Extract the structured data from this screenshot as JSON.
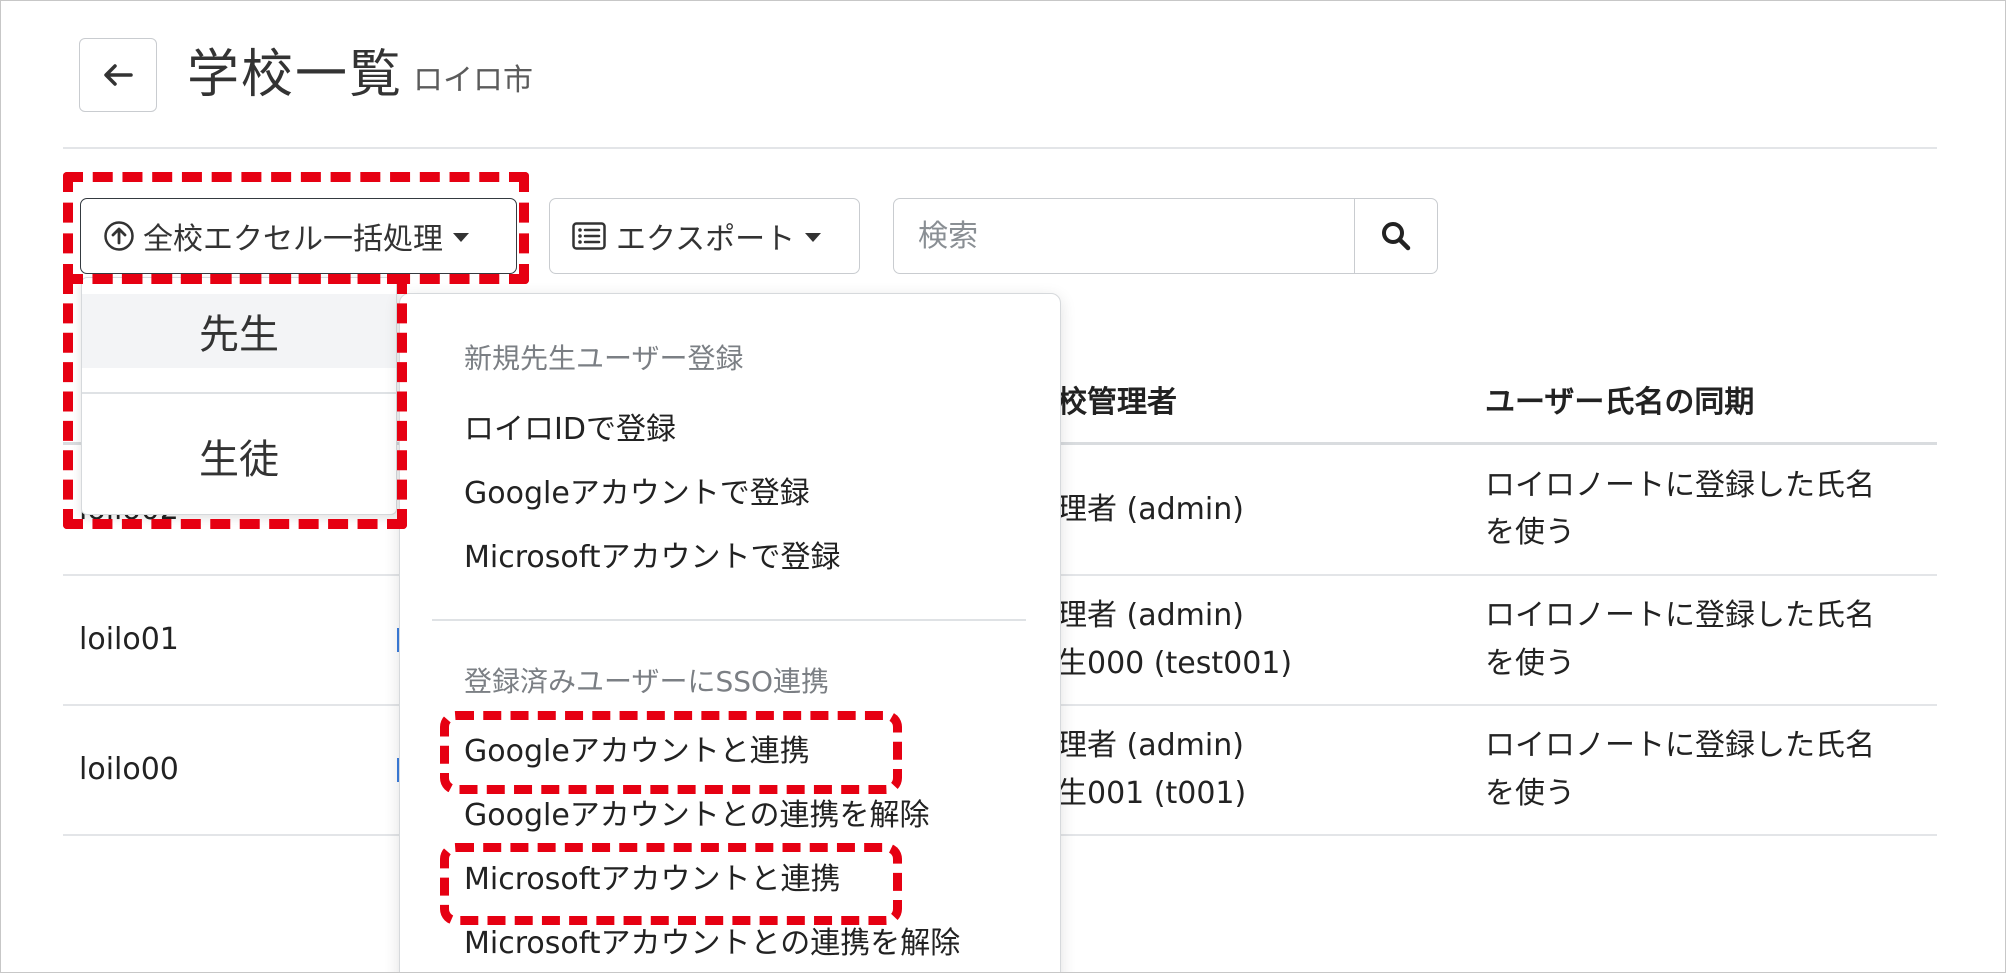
{
  "header": {
    "title": "学校一覧",
    "subtitle": "ロイロ市",
    "back_icon": "arrow-left-icon"
  },
  "toolbar": {
    "bulk_label": "全校エクセル一括処理",
    "bulk_icon": "upload-circle-icon",
    "export_label": "エクスポート",
    "export_icon": "list-icon",
    "search_placeholder": "検索",
    "search_icon": "search-icon"
  },
  "table": {
    "columns": [
      "校管理者",
      "ユーザー氏名の同期"
    ],
    "rows": [
      {
        "code": "loilo02",
        "admin": [
          "理者 (admin)"
        ],
        "sync": [
          "ロイロノートに登録した氏名",
          "を使う"
        ]
      },
      {
        "code": "loilo01",
        "admin": [
          "理者 (admin)",
          "生000 (test001)"
        ],
        "sync": [
          "ロイロノートに登録した氏名",
          "を使う"
        ]
      },
      {
        "code": "loilo00",
        "admin": [
          "理者 (admin)",
          "生001 (t001)"
        ],
        "sync": [
          "ロイロノートに登録した氏名",
          "を使う"
        ]
      }
    ]
  },
  "mini_menu": {
    "items": [
      "先生",
      "生徒"
    ],
    "active": "先生"
  },
  "dropdown": {
    "section1_header": "新規先生ユーザー登録",
    "section1_items": [
      "ロイロIDで登録",
      "Googleアカウントで登録",
      "Microsoftアカウントで登録"
    ],
    "section2_header": "登録済みユーザーにSSO連携",
    "section2_items": [
      "Googleアカウントと連携",
      "Googleアカウントとの連携を解除",
      "Microsoftアカウントと連携",
      "Microsoftアカウントとの連携を解除"
    ]
  },
  "colors": {
    "highlight": "#e60012",
    "row_accent": "#3b7ddd"
  }
}
